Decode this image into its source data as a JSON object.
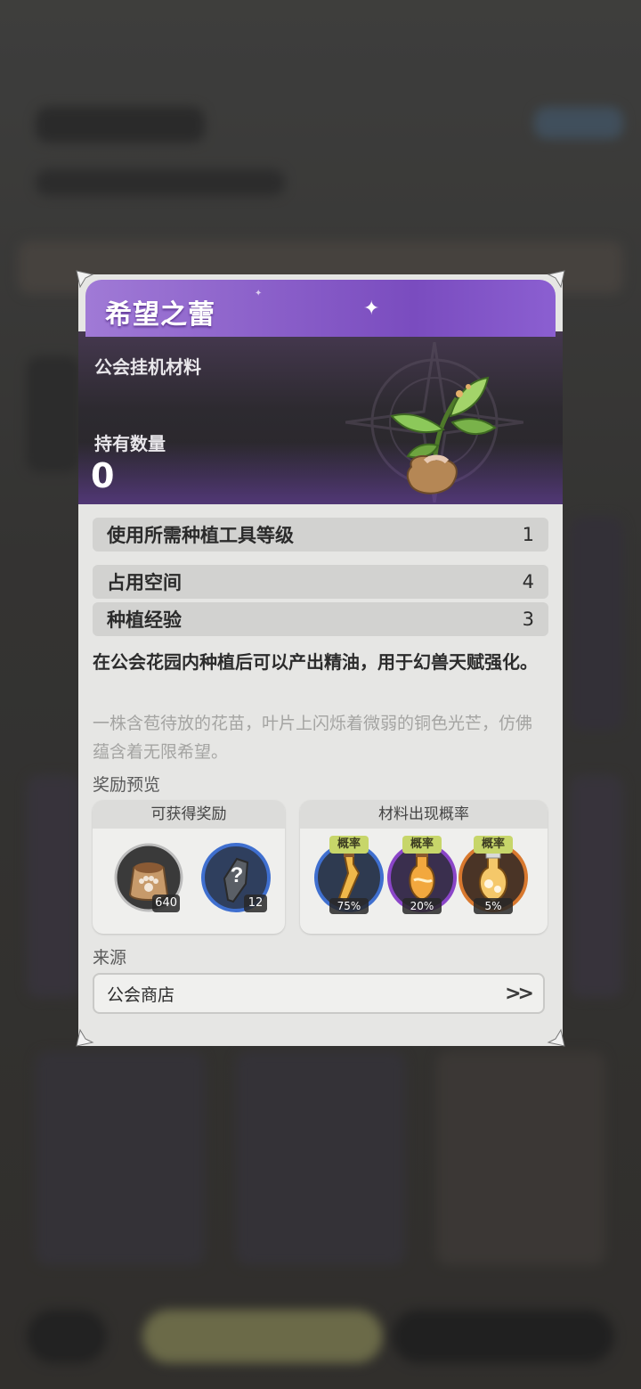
{
  "item": {
    "name": "希望之蕾",
    "category": "公会挂机材料",
    "owned_label": "持有数量",
    "owned_value": "0"
  },
  "stats": [
    {
      "label": "使用所需种植工具等级",
      "value": "1"
    },
    {
      "label": "占用空间",
      "value": "4"
    },
    {
      "label": "种植经验",
      "value": "3"
    }
  ],
  "description": "在公会花园内种植后可以产出精油，用于幻兽天赋强化。",
  "flavor_text": "一株含苞待放的花苗，叶片上闪烁着微弱的铜色光芒，仿佛蕴含着无限希望。",
  "rewards_preview": {
    "section_label": "奖励预览",
    "obtainable": {
      "title": "可获得奖励",
      "items": [
        {
          "icon": "pet-food-sack-icon",
          "count": "640"
        },
        {
          "icon": "mystery-shard-icon",
          "count": "12"
        }
      ]
    },
    "material_rates": {
      "title": "材料出现概率",
      "items": [
        {
          "icon": "essential-oil-blue-icon",
          "tag": "概率",
          "rate": "75%"
        },
        {
          "icon": "essential-oil-purple-icon",
          "tag": "概率",
          "rate": "20%"
        },
        {
          "icon": "essential-oil-orange-icon",
          "tag": "概率",
          "rate": "5%"
        }
      ]
    }
  },
  "source": {
    "section_label": "来源",
    "items": [
      {
        "name": "公会商店"
      }
    ]
  },
  "colors": {
    "title_purple": "#8a5fc9",
    "rate_tag": "#c7d66a",
    "ring_blue": "#3f6fcf",
    "ring_purple": "#8a45c8",
    "ring_orange": "#d8782e"
  }
}
